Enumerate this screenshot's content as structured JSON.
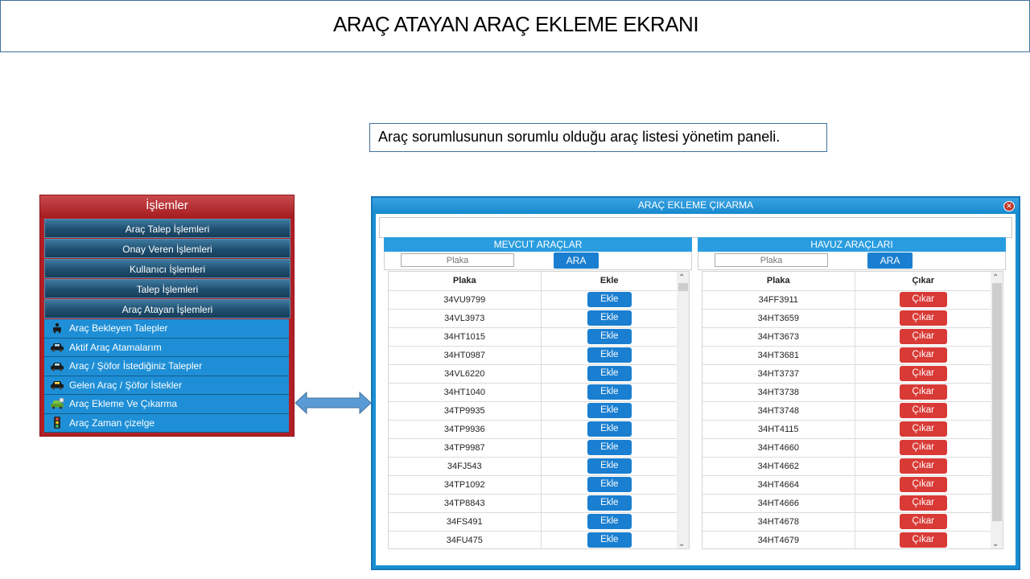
{
  "page": {
    "title": "ARAÇ ATAYAN ARAÇ EKLEME EKRANI",
    "caption": "Araç sorumlusunun  sorumlu olduğu araç listesi yönetim paneli."
  },
  "menu": {
    "header": "İşlemler",
    "items": [
      "Araç Talep İşlemleri",
      "Onay Veren İşlemleri",
      "Kullanıcı İşlemleri",
      "Talep İşlemleri",
      "Araç Atayan İşlemleri"
    ],
    "subitems": [
      {
        "label": "Araç Bekleyen Talepler",
        "icon": "waiting-car-icon"
      },
      {
        "label": "Aktif Araç Atamalarım",
        "icon": "car-icon"
      },
      {
        "label": "Araç / Şöfor İstediğiniz Talepler",
        "icon": "car-icon"
      },
      {
        "label": "Gelen Araç / Şöfor İstekler",
        "icon": "car-icon"
      },
      {
        "label": "Araç Ekleme Ve Çıkarma",
        "icon": "car-add-icon"
      },
      {
        "label": "Araç Zaman çizelge",
        "icon": "traffic-light-icon"
      }
    ]
  },
  "dialog": {
    "title": "ARAÇ EKLEME ÇIKARMA",
    "left": {
      "header": "MEVCUT ARAÇLAR",
      "search_placeholder": "Plaka",
      "search_button": "ARA",
      "col_plate": "Plaka",
      "col_action": "Ekle",
      "action_label": "Ekle",
      "rows": [
        "34VU9799",
        "34VL3973",
        "34HT1015",
        "34HT0987",
        "34VL6220",
        "34HT1040",
        "34TP9935",
        "34TP9936",
        "34TP9987",
        "34FJ543",
        "34TP1092",
        "34TP8843",
        "34FS491",
        "34FU475"
      ]
    },
    "right": {
      "header": "HAVUZ ARAÇLARI",
      "search_placeholder": "Plaka",
      "search_button": "ARA",
      "col_plate": "Plaka",
      "col_action": "Çıkar",
      "action_label": "Çıkar",
      "rows": [
        "34FF3911",
        "34HT3659",
        "34HT3673",
        "34HT3681",
        "34HT3737",
        "34HT3738",
        "34HT3748",
        "34HT4115",
        "34HT4660",
        "34HT4662",
        "34HT4664",
        "34HT4666",
        "34HT4678",
        "34HT4679"
      ]
    }
  },
  "colors": {
    "accent": "#1a8fd3",
    "danger": "#d93a36",
    "menu_bg": "#b11f24"
  }
}
